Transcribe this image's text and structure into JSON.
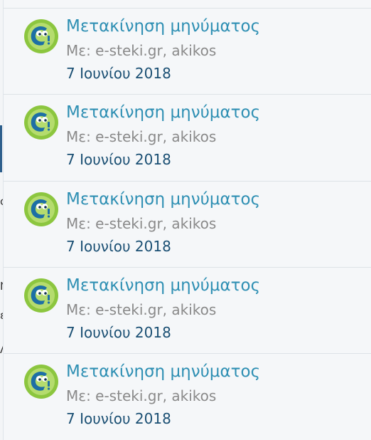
{
  "notifications": [
    {
      "title": "Μετακίνηση μηνύματος",
      "meta": "Με: e-steki.gr, akikos",
      "date": "7 Ιουνίου 2018",
      "icon": "esteki-logo-icon"
    },
    {
      "title": "Μετακίνηση μηνύματος",
      "meta": "Με: e-steki.gr, akikos",
      "date": "7 Ιουνίου 2018",
      "icon": "esteki-logo-icon"
    },
    {
      "title": "Μετακίνηση μηνύματος",
      "meta": "Με: e-steki.gr, akikos",
      "date": "7 Ιουνίου 2018",
      "icon": "esteki-logo-icon"
    },
    {
      "title": "Μετακίνηση μηνύματος",
      "meta": "Με: e-steki.gr, akikos",
      "date": "7 Ιουνίου 2018",
      "icon": "esteki-logo-icon"
    },
    {
      "title": "Μετακίνηση μηνύματος",
      "meta": "Με: e-steki.gr, akikos",
      "date": "7 Ιουνίου 2018",
      "icon": "esteki-logo-icon"
    }
  ],
  "colors": {
    "title": "#2e8fb3",
    "meta": "#8a8a8a",
    "date": "#1a4f73",
    "background": "#f5f7f9",
    "logo_green": "#8cc63f",
    "logo_blue": "#1d6fa5"
  }
}
